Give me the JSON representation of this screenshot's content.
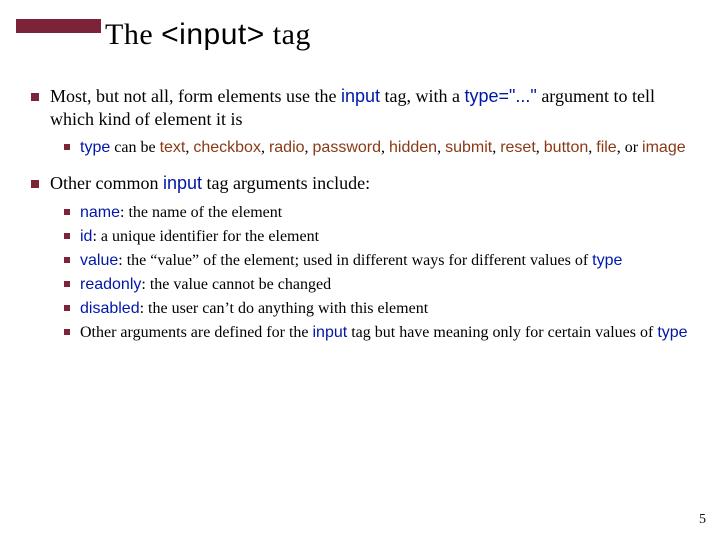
{
  "page_number": "5",
  "title": {
    "prefix": "The ",
    "tag_open": "<",
    "tag_name": "input",
    "tag_close": ">",
    "suffix": " tag"
  },
  "bullets": [
    {
      "fragments": [
        {
          "t": "Most, but not all, form elements use the "
        },
        {
          "t": "input",
          "cls": "code blue"
        },
        {
          "t": " tag, with a "
        },
        {
          "t": "type=\"...\"",
          "cls": "code blue"
        },
        {
          "t": " argument to tell which kind of element it is"
        }
      ],
      "children": [
        {
          "fragments": [
            {
              "t": "type",
              "cls": "code blue"
            },
            {
              "t": " can be "
            },
            {
              "t": "text",
              "cls": "code brown"
            },
            {
              "t": ", "
            },
            {
              "t": "checkbox",
              "cls": "code brown"
            },
            {
              "t": ", "
            },
            {
              "t": "radio",
              "cls": "code brown"
            },
            {
              "t": ", "
            },
            {
              "t": "password",
              "cls": "code brown"
            },
            {
              "t": ", "
            },
            {
              "t": "hidden",
              "cls": "code brown"
            },
            {
              "t": ", "
            },
            {
              "t": "submit",
              "cls": "code brown"
            },
            {
              "t": ", "
            },
            {
              "t": "reset",
              "cls": "code brown"
            },
            {
              "t": ", "
            },
            {
              "t": "button",
              "cls": "code brown"
            },
            {
              "t": ", "
            },
            {
              "t": "file",
              "cls": "code brown"
            },
            {
              "t": ", or "
            },
            {
              "t": "image",
              "cls": "code brown"
            }
          ]
        }
      ]
    },
    {
      "fragments": [
        {
          "t": "Other common "
        },
        {
          "t": "input",
          "cls": "code blue"
        },
        {
          "t": " tag arguments include:"
        }
      ],
      "children": [
        {
          "fragments": [
            {
              "t": "name",
              "cls": "code blue"
            },
            {
              "t": ": the name of the element"
            }
          ]
        },
        {
          "fragments": [
            {
              "t": "id",
              "cls": "code blue"
            },
            {
              "t": ": a unique identifier for the element"
            }
          ]
        },
        {
          "fragments": [
            {
              "t": "value",
              "cls": "code blue"
            },
            {
              "t": ": the “value” of the element; used in different ways for different values of "
            },
            {
              "t": "type",
              "cls": "code blue"
            }
          ]
        },
        {
          "fragments": [
            {
              "t": "readonly",
              "cls": "code blue"
            },
            {
              "t": ": the value cannot be changed"
            }
          ]
        },
        {
          "fragments": [
            {
              "t": "disabled",
              "cls": "code blue"
            },
            {
              "t": ": the user can’t do anything with this element"
            }
          ]
        },
        {
          "fragments": [
            {
              "t": "Other arguments are defined for the "
            },
            {
              "t": "input",
              "cls": "code blue"
            },
            {
              "t": " tag but have meaning only for certain values of "
            },
            {
              "t": "type",
              "cls": "code blue"
            }
          ]
        }
      ]
    }
  ]
}
